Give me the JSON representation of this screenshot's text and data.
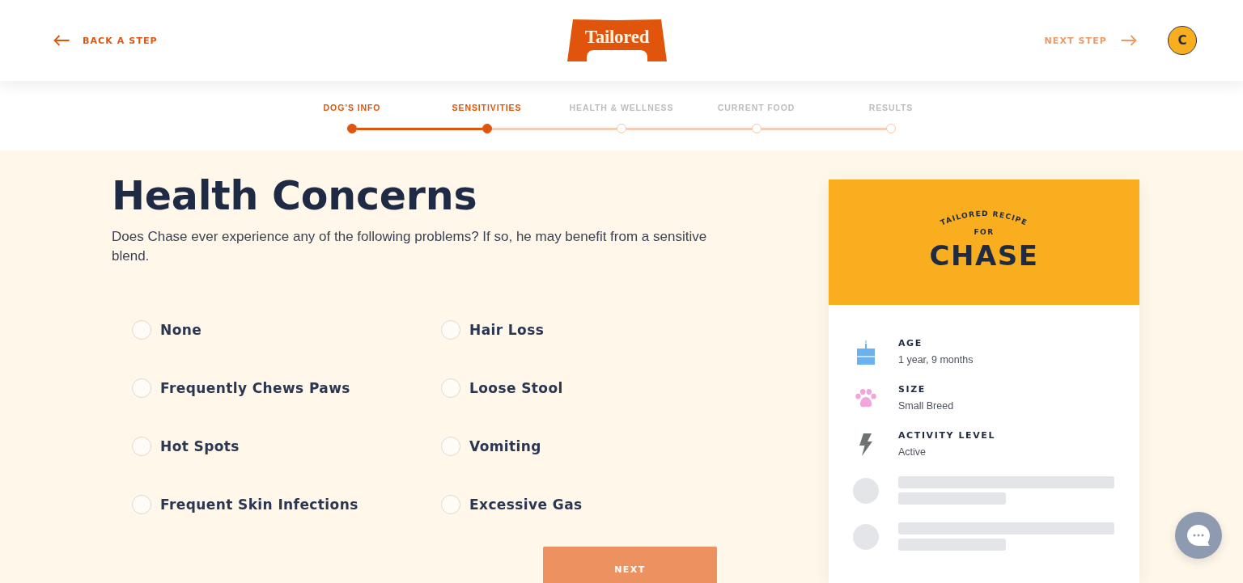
{
  "header": {
    "back_link": {
      "label": "BACK A STEP"
    },
    "logo": {
      "text": "Tailored"
    },
    "next_link": {
      "label": "NEXT STEP",
      "disabled": true
    },
    "avatar": {
      "initial": "C"
    }
  },
  "progress": {
    "steps": [
      {
        "label": "DOG’S INFO",
        "reached": true
      },
      {
        "label": "SENSITIVITIES",
        "reached": true
      },
      {
        "label": "HEALTH & WELLNESS",
        "reached": false
      },
      {
        "label": "CURRENT FOOD",
        "reached": false
      },
      {
        "label": "RESULTS",
        "reached": false
      }
    ]
  },
  "question": {
    "title": "Health Concerns",
    "description": "Does Chase ever experience any of the following problems? If so, he may benefit from a sensitive blend.",
    "options": [
      {
        "label": "None",
        "checked": false
      },
      {
        "label": "Hair Loss",
        "checked": false
      },
      {
        "label": "Frequently Chews Paws",
        "checked": false
      },
      {
        "label": "Loose Stool",
        "checked": false
      },
      {
        "label": "Hot Spots",
        "checked": false
      },
      {
        "label": "Vomiting",
        "checked": false
      },
      {
        "label": "Frequent Skin Infections",
        "checked": false
      },
      {
        "label": "Excessive Gas",
        "checked": false
      }
    ],
    "next_button": {
      "label": "NEXT"
    }
  },
  "recipe_card": {
    "caption": "TAILORED RECIPE",
    "for": "FOR",
    "name": "CHASE",
    "rows": [
      {
        "kind": "age",
        "label": "AGE",
        "value": "1 year, 9 months"
      },
      {
        "kind": "size",
        "label": "SIZE",
        "value": "Small Breed"
      },
      {
        "kind": "activity",
        "label": "ACTIVITY LEVEL",
        "value": "Active"
      },
      {
        "kind": "placeholder"
      },
      {
        "kind": "placeholder"
      }
    ]
  }
}
